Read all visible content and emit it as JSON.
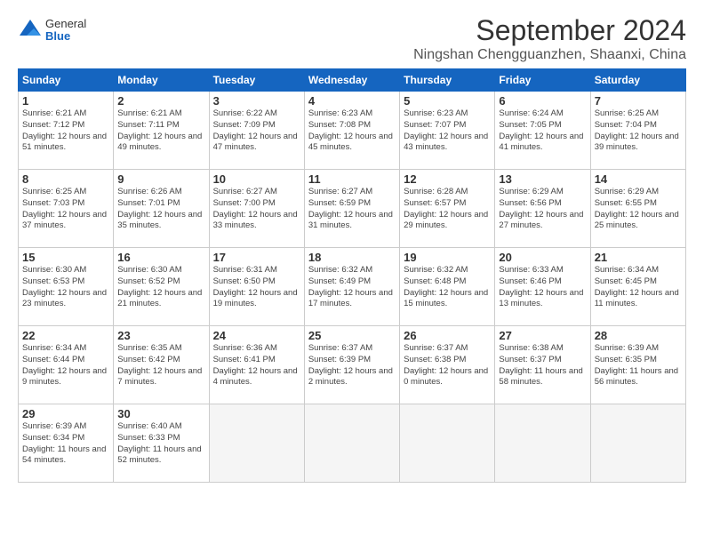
{
  "header": {
    "logo_general": "General",
    "logo_blue": "Blue",
    "month_title": "September 2024",
    "location": "Ningshan Chengguanzhen, Shaanxi, China"
  },
  "days_of_week": [
    "Sunday",
    "Monday",
    "Tuesday",
    "Wednesday",
    "Thursday",
    "Friday",
    "Saturday"
  ],
  "weeks": [
    [
      {
        "day": "1",
        "sunrise": "6:21 AM",
        "sunset": "7:12 PM",
        "daylight": "12 hours and 51 minutes."
      },
      {
        "day": "2",
        "sunrise": "6:21 AM",
        "sunset": "7:11 PM",
        "daylight": "12 hours and 49 minutes."
      },
      {
        "day": "3",
        "sunrise": "6:22 AM",
        "sunset": "7:09 PM",
        "daylight": "12 hours and 47 minutes."
      },
      {
        "day": "4",
        "sunrise": "6:23 AM",
        "sunset": "7:08 PM",
        "daylight": "12 hours and 45 minutes."
      },
      {
        "day": "5",
        "sunrise": "6:23 AM",
        "sunset": "7:07 PM",
        "daylight": "12 hours and 43 minutes."
      },
      {
        "day": "6",
        "sunrise": "6:24 AM",
        "sunset": "7:05 PM",
        "daylight": "12 hours and 41 minutes."
      },
      {
        "day": "7",
        "sunrise": "6:25 AM",
        "sunset": "7:04 PM",
        "daylight": "12 hours and 39 minutes."
      }
    ],
    [
      {
        "day": "8",
        "sunrise": "6:25 AM",
        "sunset": "7:03 PM",
        "daylight": "12 hours and 37 minutes."
      },
      {
        "day": "9",
        "sunrise": "6:26 AM",
        "sunset": "7:01 PM",
        "daylight": "12 hours and 35 minutes."
      },
      {
        "day": "10",
        "sunrise": "6:27 AM",
        "sunset": "7:00 PM",
        "daylight": "12 hours and 33 minutes."
      },
      {
        "day": "11",
        "sunrise": "6:27 AM",
        "sunset": "6:59 PM",
        "daylight": "12 hours and 31 minutes."
      },
      {
        "day": "12",
        "sunrise": "6:28 AM",
        "sunset": "6:57 PM",
        "daylight": "12 hours and 29 minutes."
      },
      {
        "day": "13",
        "sunrise": "6:29 AM",
        "sunset": "6:56 PM",
        "daylight": "12 hours and 27 minutes."
      },
      {
        "day": "14",
        "sunrise": "6:29 AM",
        "sunset": "6:55 PM",
        "daylight": "12 hours and 25 minutes."
      }
    ],
    [
      {
        "day": "15",
        "sunrise": "6:30 AM",
        "sunset": "6:53 PM",
        "daylight": "12 hours and 23 minutes."
      },
      {
        "day": "16",
        "sunrise": "6:30 AM",
        "sunset": "6:52 PM",
        "daylight": "12 hours and 21 minutes."
      },
      {
        "day": "17",
        "sunrise": "6:31 AM",
        "sunset": "6:50 PM",
        "daylight": "12 hours and 19 minutes."
      },
      {
        "day": "18",
        "sunrise": "6:32 AM",
        "sunset": "6:49 PM",
        "daylight": "12 hours and 17 minutes."
      },
      {
        "day": "19",
        "sunrise": "6:32 AM",
        "sunset": "6:48 PM",
        "daylight": "12 hours and 15 minutes."
      },
      {
        "day": "20",
        "sunrise": "6:33 AM",
        "sunset": "6:46 PM",
        "daylight": "12 hours and 13 minutes."
      },
      {
        "day": "21",
        "sunrise": "6:34 AM",
        "sunset": "6:45 PM",
        "daylight": "12 hours and 11 minutes."
      }
    ],
    [
      {
        "day": "22",
        "sunrise": "6:34 AM",
        "sunset": "6:44 PM",
        "daylight": "12 hours and 9 minutes."
      },
      {
        "day": "23",
        "sunrise": "6:35 AM",
        "sunset": "6:42 PM",
        "daylight": "12 hours and 7 minutes."
      },
      {
        "day": "24",
        "sunrise": "6:36 AM",
        "sunset": "6:41 PM",
        "daylight": "12 hours and 4 minutes."
      },
      {
        "day": "25",
        "sunrise": "6:37 AM",
        "sunset": "6:39 PM",
        "daylight": "12 hours and 2 minutes."
      },
      {
        "day": "26",
        "sunrise": "6:37 AM",
        "sunset": "6:38 PM",
        "daylight": "12 hours and 0 minutes."
      },
      {
        "day": "27",
        "sunrise": "6:38 AM",
        "sunset": "6:37 PM",
        "daylight": "11 hours and 58 minutes."
      },
      {
        "day": "28",
        "sunrise": "6:39 AM",
        "sunset": "6:35 PM",
        "daylight": "11 hours and 56 minutes."
      }
    ],
    [
      {
        "day": "29",
        "sunrise": "6:39 AM",
        "sunset": "6:34 PM",
        "daylight": "11 hours and 54 minutes."
      },
      {
        "day": "30",
        "sunrise": "6:40 AM",
        "sunset": "6:33 PM",
        "daylight": "11 hours and 52 minutes."
      },
      null,
      null,
      null,
      null,
      null
    ]
  ]
}
